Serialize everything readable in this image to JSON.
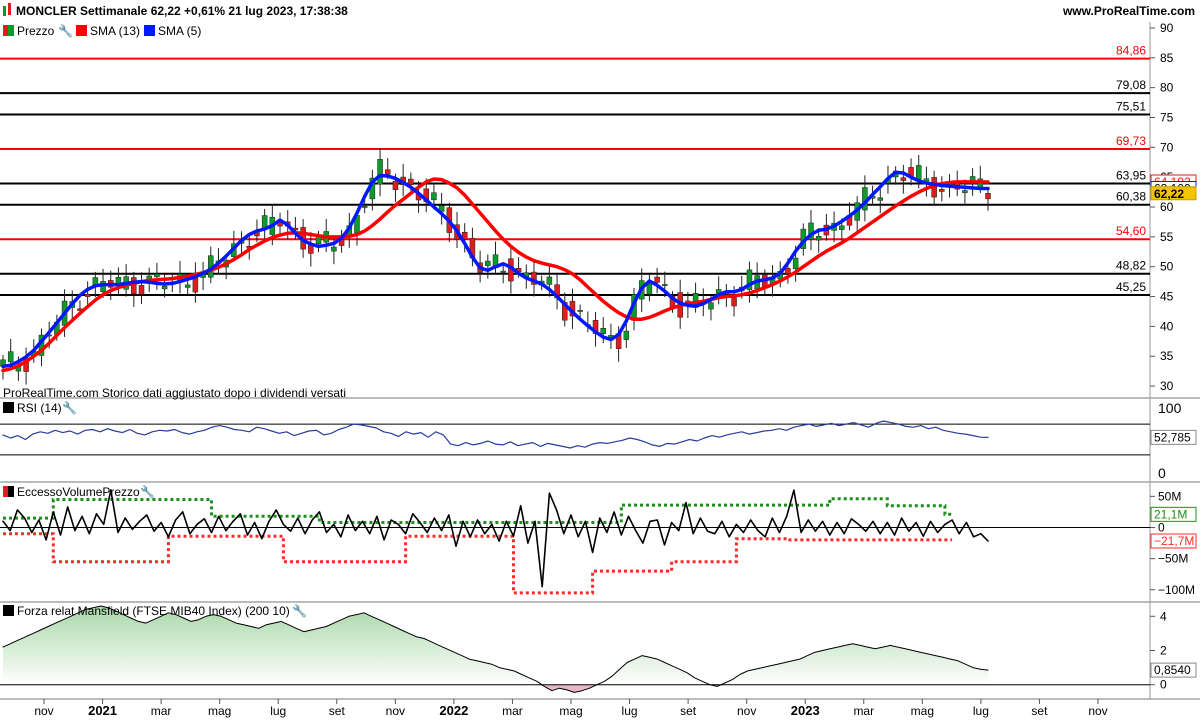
{
  "header": {
    "title": "MONCLER Settimanale 62,22 +0,61% 21 lug 2023, 17:38:38",
    "site": "www.ProRealTime.com"
  },
  "colors": {
    "up": "#0e9a2a",
    "down": "#e21b1b",
    "sma13": "#ff0000",
    "sma5": "#0018ff",
    "red_level": "#ff0000",
    "black_level": "#000000",
    "rsi": "#2a3c9c",
    "volume_top": "#1d8f1d",
    "volume_bottom": "#ff2a2a",
    "mansfield_fill": "#9fd39f"
  },
  "legend": {
    "price": "Prezzo",
    "sma13": "SMA (13)",
    "sma5": "SMA (5)",
    "note": "ProRealTime.com  Storico dati aggiustato dopo i dividendi versati"
  },
  "chart_data": [
    {
      "type": "candlestick",
      "name_panel": "price",
      "ylim": [
        28,
        91
      ],
      "yticks": [
        30,
        35,
        40,
        45,
        50,
        55,
        60,
        65,
        70,
        75,
        80,
        85,
        90
      ],
      "levels": [
        {
          "value": 84.86,
          "label": "84,86",
          "color": "red"
        },
        {
          "value": 79.08,
          "label": "79,08",
          "color": "black"
        },
        {
          "value": 75.51,
          "label": "75,51",
          "color": "black"
        },
        {
          "value": 69.73,
          "label": "69,73",
          "color": "red"
        },
        {
          "value": 63.95,
          "label": "63,95",
          "color": "black"
        },
        {
          "value": 60.38,
          "label": "60,38",
          "color": "black"
        },
        {
          "value": 54.6,
          "label": "54,60",
          "color": "red"
        },
        {
          "value": 48.82,
          "label": "48,82",
          "color": "black"
        },
        {
          "value": 45.25,
          "label": "45,25",
          "color": "black"
        }
      ],
      "last_values": [
        {
          "label": "64,192",
          "value": 64.19,
          "style": "red"
        },
        {
          "label": "63,100",
          "value": 63.1,
          "style": "blue"
        },
        {
          "label": "62,22",
          "value": 62.22,
          "style": "price"
        }
      ],
      "sma13": [
        32.6,
        32.9,
        33.4,
        34.1,
        35,
        36,
        37.2,
        38.5,
        39.8,
        41,
        42.2,
        43.3,
        44.4,
        45.3,
        46,
        46.5,
        46.9,
        47.2,
        47.5,
        47.7,
        47.8,
        47.9,
        48,
        48.2,
        48.4,
        48.7,
        49,
        49.4,
        49.9,
        50.5,
        51.2,
        52,
        52.9,
        53.6,
        54.3,
        54.9,
        55.3,
        55.6,
        55.7,
        55.6,
        55.4,
        55.2,
        55,
        55,
        55,
        55.1,
        55.4,
        56,
        56.9,
        58,
        59.2,
        60.3,
        61.3,
        62.3,
        63.3,
        64.2,
        64.7,
        64.6,
        64,
        63.2,
        62,
        60.5,
        59,
        57.5,
        56,
        54.6,
        53.4,
        52.4,
        51.6,
        51,
        50.6,
        50.3,
        50,
        49.5,
        48.8,
        47.8,
        46.6,
        45.4,
        44.2,
        43.2,
        42.3,
        41.6,
        41.2,
        41.2,
        41.5,
        42,
        42.6,
        43.1,
        43.5,
        43.8,
        44,
        44.2,
        44.5,
        44.8,
        45,
        45.1,
        45.3,
        45.6,
        46,
        46.5,
        47,
        47.6,
        48.3,
        49.1,
        50,
        50.9,
        51.8,
        52.6,
        53.3,
        54,
        54.8,
        55.7,
        56.6,
        57.5,
        58.4,
        59.3,
        60.2,
        61,
        61.8,
        62.5,
        63.1,
        63.6,
        63.9,
        64.1,
        64.2,
        64.2,
        64.2,
        64.2,
        64.19
      ],
      "sma5": [
        33.3,
        33.5,
        34.1,
        34.9,
        36,
        37.5,
        39,
        40.6,
        42.2,
        43.8,
        45.2,
        46.2,
        46.8,
        47,
        47,
        47,
        47.2,
        47.4,
        47.5,
        47.4,
        47.2,
        47.1,
        47.2,
        47.5,
        47.9,
        48.3,
        48.9,
        49.6,
        50.6,
        51.8,
        53.1,
        54.4,
        55.4,
        56,
        56.3,
        56.9,
        57.8,
        57,
        55.6,
        54.4,
        53.8,
        53.4,
        53.6,
        53.9,
        54.8,
        56.5,
        59,
        61.8,
        64.2,
        65.3,
        65.2,
        64.8,
        64.1,
        63.3,
        62.3,
        61.2,
        60,
        58.9,
        57.6,
        56,
        53.9,
        51.6,
        49.8,
        49.4,
        50,
        50.5,
        49.9,
        48.9,
        48.1,
        47.6,
        47.1,
        46.2,
        45,
        43.7,
        42.4,
        41.2,
        40.1,
        39.1,
        38.2,
        37.8,
        38.6,
        40.9,
        43.9,
        46.4,
        47.6,
        46.9,
        45.9,
        44.7,
        43.9,
        43.5,
        43.4,
        43.8,
        44.5,
        45.3,
        45.8,
        45.8,
        46.2,
        47,
        47.6,
        47.8,
        48.1,
        48.9,
        50.6,
        52.6,
        54.2,
        55.4,
        56.1,
        56.3,
        56.8,
        57.6,
        58.5,
        59.5,
        60.7,
        62.1,
        63.4,
        64.8,
        65.8,
        65.7,
        65,
        64.4,
        64,
        63.8,
        63.6,
        63.5,
        63.4,
        63.3,
        63.2,
        63.1,
        63.1
      ],
      "candles": "auto"
    },
    {
      "type": "line",
      "name_panel": "rsi",
      "title": "RSI (14)",
      "ylim": [
        0,
        100
      ],
      "yticks": [
        0,
        100
      ],
      "bands": [
        70,
        30
      ],
      "last_label": "52,785",
      "values": [
        56,
        52,
        55,
        50,
        57,
        60,
        58,
        62,
        59,
        61,
        57,
        62,
        63,
        60,
        64,
        61,
        59,
        63,
        58,
        56,
        60,
        62,
        61,
        63,
        59,
        57,
        60,
        62,
        66,
        68,
        66,
        63,
        62,
        60,
        66,
        64,
        61,
        58,
        60,
        55,
        58,
        61,
        62,
        56,
        58,
        63,
        66,
        70,
        69,
        67,
        65,
        60,
        58,
        54,
        60,
        57,
        59,
        53,
        60,
        56,
        44,
        42,
        46,
        43,
        45,
        48,
        44,
        43,
        47,
        42,
        44,
        46,
        41,
        45,
        43,
        41,
        39,
        42,
        40,
        44,
        46,
        45,
        47,
        49,
        52,
        50,
        47,
        43,
        41,
        45,
        44,
        47,
        50,
        48,
        52,
        55,
        53,
        56,
        58,
        60,
        57,
        59,
        61,
        62,
        64,
        62,
        66,
        68,
        70,
        67,
        69,
        71,
        68,
        70,
        72,
        69,
        66,
        71,
        74,
        72,
        70,
        67,
        66,
        68,
        64,
        66,
        62,
        60,
        58,
        57,
        55,
        53,
        52.785
      ]
    },
    {
      "type": "line",
      "name_panel": "volume",
      "title": "EccessoVolumePrezzo",
      "ylim": [
        -110,
        65
      ],
      "yticks": [
        50,
        0,
        -50,
        -100
      ],
      "ytick_labels": [
        "50M",
        "0",
        "−50M",
        "−100M"
      ],
      "last_labels": [
        {
          "label": "21,1M",
          "value": 21.1,
          "style": "green"
        },
        {
          "label": "−21,7M",
          "value": -21.7,
          "style": "red"
        }
      ],
      "values": [
        10,
        -5,
        28,
        15,
        -8,
        12,
        -20,
        25,
        -12,
        33,
        -5,
        18,
        -10,
        22,
        5,
        60,
        -8,
        15,
        -3,
        10,
        20,
        -6,
        8,
        -15,
        12,
        25,
        -10,
        5,
        14,
        -8,
        18,
        -5,
        10,
        22,
        -12,
        8,
        -18,
        10,
        28,
        5,
        -6,
        15,
        -10,
        12,
        25,
        -8,
        5,
        -15,
        20,
        -5,
        10,
        -10,
        18,
        -20,
        12,
        5,
        -10,
        22,
        8,
        -8,
        15,
        -5,
        20,
        -30,
        10,
        -15,
        12,
        -10,
        5,
        -22,
        10,
        -14,
        35,
        -25,
        10,
        -95,
        55,
        28,
        -10,
        20,
        -15,
        10,
        -40,
        15,
        -8,
        25,
        -12,
        18,
        -5,
        -25,
        10,
        12,
        -28,
        8,
        -5,
        40,
        -10,
        15,
        -6,
        -10,
        10,
        -15,
        5,
        -8,
        12,
        -5,
        -15,
        15,
        -8,
        18,
        60,
        -8,
        12,
        -6,
        10,
        -12,
        8,
        -10,
        14,
        5,
        -6,
        10,
        -10,
        8,
        -12,
        15,
        -6,
        8,
        -14,
        10,
        -8,
        5,
        12,
        -10,
        8,
        -15,
        -10,
        -21.7
      ],
      "upper": [
        45,
        45,
        45,
        45,
        45,
        45,
        45,
        45,
        45,
        45,
        45,
        45,
        45,
        45,
        45,
        48,
        48,
        48,
        48,
        48,
        48,
        48,
        48,
        48,
        48,
        48,
        48,
        48,
        48,
        48,
        48,
        48,
        48,
        48,
        48,
        48,
        48,
        48,
        48,
        48,
        48,
        48,
        48,
        48,
        45,
        45,
        45,
        45,
        45,
        45,
        45,
        45,
        45,
        45,
        45,
        45,
        45,
        45,
        45,
        45,
        45,
        45,
        45,
        45,
        45,
        45,
        45,
        45,
        45,
        45,
        45,
        45,
        45,
        45,
        45,
        45,
        45,
        45,
        45,
        45,
        45,
        45,
        45,
        45,
        45,
        45,
        45,
        45,
        45,
        45,
        45,
        45,
        45,
        45,
        45,
        45,
        45,
        45,
        45,
        45,
        45,
        45,
        45,
        45,
        45,
        45,
        45,
        45,
        45,
        45,
        45,
        45,
        45,
        45,
        45,
        45,
        45,
        45,
        45,
        45,
        45,
        45,
        45,
        45,
        45,
        45,
        45,
        45,
        45,
        45,
        45,
        45,
        21.1
      ],
      "lower": [
        -25,
        -25,
        -25,
        -25,
        -25,
        -25,
        -25,
        -25,
        -25,
        -25,
        -25,
        -25,
        -25,
        -25,
        -25,
        -25,
        -25,
        -25,
        -25,
        -25,
        -25,
        -25,
        -25,
        -25,
        -25,
        -25,
        -25,
        -25,
        -25,
        -25,
        -25,
        -25,
        -25,
        -25,
        -25,
        -25,
        -25,
        -25,
        -25,
        -25,
        -25,
        -25,
        -25,
        -25,
        -25,
        -25,
        -25,
        -25,
        -25,
        -25,
        -25,
        -25,
        -25,
        -25,
        -25,
        -25,
        -25,
        -25,
        -25,
        -25,
        -25,
        -25,
        -25,
        -25,
        -25,
        -25,
        -25,
        -25,
        -25,
        -25,
        -25,
        -25,
        -25,
        -25,
        -25,
        -25,
        -25,
        -25,
        -25,
        -25,
        -25,
        -25,
        -25,
        -25,
        -25,
        -25,
        -25,
        -25,
        -25,
        -25,
        -25,
        -25,
        -25,
        -25,
        -25,
        -25,
        -25,
        -25,
        -25,
        -25,
        -25,
        -25,
        -25,
        -25,
        -25,
        -25,
        -25,
        -25,
        -25,
        -25,
        -25,
        -25,
        -25,
        -25,
        -25,
        -25,
        -25,
        -25,
        -25,
        -25,
        -25,
        -25,
        -25,
        -25,
        -25,
        -25,
        -25,
        -25,
        -25,
        -25,
        -25,
        -25,
        -21.7
      ]
    },
    {
      "type": "area",
      "name_panel": "mansfield",
      "title": "Forza relat Mansfield (FTSE MIB40 Index) (200 10)",
      "ylim": [
        -0.6,
        4.6
      ],
      "yticks": [
        4,
        2,
        0
      ],
      "last_label": "0,8540",
      "values": [
        2.2,
        2.4,
        2.6,
        2.8,
        3,
        3.2,
        3.4,
        3.6,
        3.8,
        4,
        4.2,
        4.4,
        4.5,
        4.6,
        4.5,
        4.3,
        4.1,
        3.9,
        3.7,
        3.6,
        3.8,
        4,
        4.2,
        4.1,
        3.9,
        3.7,
        3.8,
        4,
        4.1,
        4,
        3.8,
        3.6,
        3.5,
        3.4,
        3.3,
        3.5,
        3.6,
        3.7,
        3.5,
        3.3,
        3.1,
        3.2,
        3.3,
        3.4,
        3.6,
        3.8,
        4,
        4.1,
        4.2,
        4,
        3.8,
        3.6,
        3.4,
        3.2,
        3,
        2.8,
        2.7,
        2.5,
        2.3,
        2.1,
        1.9,
        1.7,
        1.5,
        1.4,
        1.3,
        1.2,
        1.0,
        0.9,
        0.8,
        0.6,
        0.4,
        0.2,
        -0.1,
        -0.35,
        -0.2,
        -0.3,
        -0.45,
        -0.35,
        -0.2,
        0,
        0.2,
        0.5,
        0.9,
        1.3,
        1.5,
        1.7,
        1.6,
        1.5,
        1.3,
        1.1,
        0.9,
        0.7,
        0.4,
        0.2,
        0,
        -0.1,
        0.1,
        0.3,
        0.6,
        0.8,
        0.9,
        1.0,
        1.1,
        1.2,
        1.3,
        1.4,
        1.5,
        1.7,
        1.9,
        2.0,
        2.1,
        2.2,
        2.3,
        2.4,
        2.3,
        2.2,
        2.1,
        2.2,
        2.3,
        2.2,
        2.1,
        2.0,
        1.9,
        1.8,
        1.7,
        1.6,
        1.5,
        1.4,
        1.2,
        1.0,
        0.9,
        0.854
      ]
    }
  ],
  "xaxis": {
    "labels": [
      "nov",
      "2021",
      "mar",
      "mag",
      "lug",
      "set",
      "nov",
      "2022",
      "mar",
      "mag",
      "lug",
      "set",
      "nov",
      "2023",
      "mar",
      "mag",
      "lug",
      "set",
      "nov"
    ],
    "bold": [
      "2021",
      "2022",
      "2023"
    ]
  }
}
